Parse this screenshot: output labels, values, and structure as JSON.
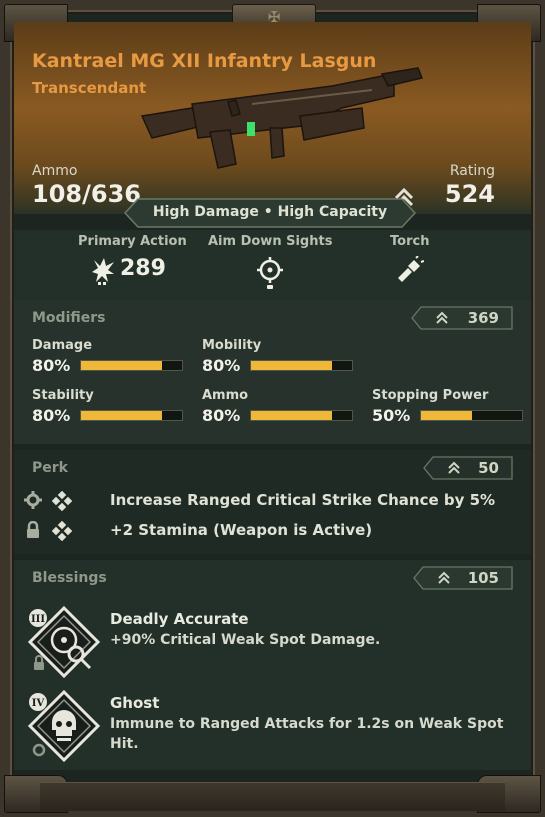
{
  "weapon": {
    "name": "Kantrael MG XII Infantry Lasgun",
    "rarity": "Transcendant",
    "ammo_label": "Ammo",
    "ammo_value": "108/636",
    "rating_label": "Rating",
    "rating_value": "524",
    "traits": "High Damage • High Capacity"
  },
  "actions": [
    {
      "label": "Primary Action",
      "value": "289",
      "icon": "burst-fire-icon"
    },
    {
      "label": "Aim Down Sights",
      "value": "",
      "icon": "crosshair-icon"
    },
    {
      "label": "Torch",
      "value": "",
      "icon": "flashlight-icon"
    }
  ],
  "modifiers": {
    "title": "Modifiers",
    "rating": "369",
    "stats": [
      {
        "label": "Damage",
        "value": "80%",
        "fill": 0.8
      },
      {
        "label": "Mobility",
        "value": "80%",
        "fill": 0.8
      },
      {
        "label": "Stability",
        "value": "80%",
        "fill": 0.8
      },
      {
        "label": "Ammo",
        "value": "80%",
        "fill": 0.8
      },
      {
        "label": "Stopping Power",
        "value": "50%",
        "fill": 0.5
      }
    ]
  },
  "perk": {
    "title": "Perk",
    "rating": "50",
    "items": [
      {
        "text": "Increase Ranged Critical Strike Chance by 5%",
        "status_icon": "gear-icon"
      },
      {
        "text": "+2 Stamina (Weapon is Active)",
        "status_icon": "lock-icon"
      }
    ]
  },
  "blessings": {
    "title": "Blessings",
    "rating": "105",
    "items": [
      {
        "name": "Deadly Accurate",
        "desc": "+90% Critical Weak Spot Damage.",
        "tier": "III",
        "icon": "crosshair-skull-icon"
      },
      {
        "name": "Ghost",
        "desc": "Immune to Ranged Attacks for 1.2s on Weak Spot Hit.",
        "tier": "IV",
        "icon": "skull-icon"
      }
    ]
  },
  "colors": {
    "accent": "#e79a42",
    "bar": "#efb838",
    "panel": "#26322b"
  }
}
